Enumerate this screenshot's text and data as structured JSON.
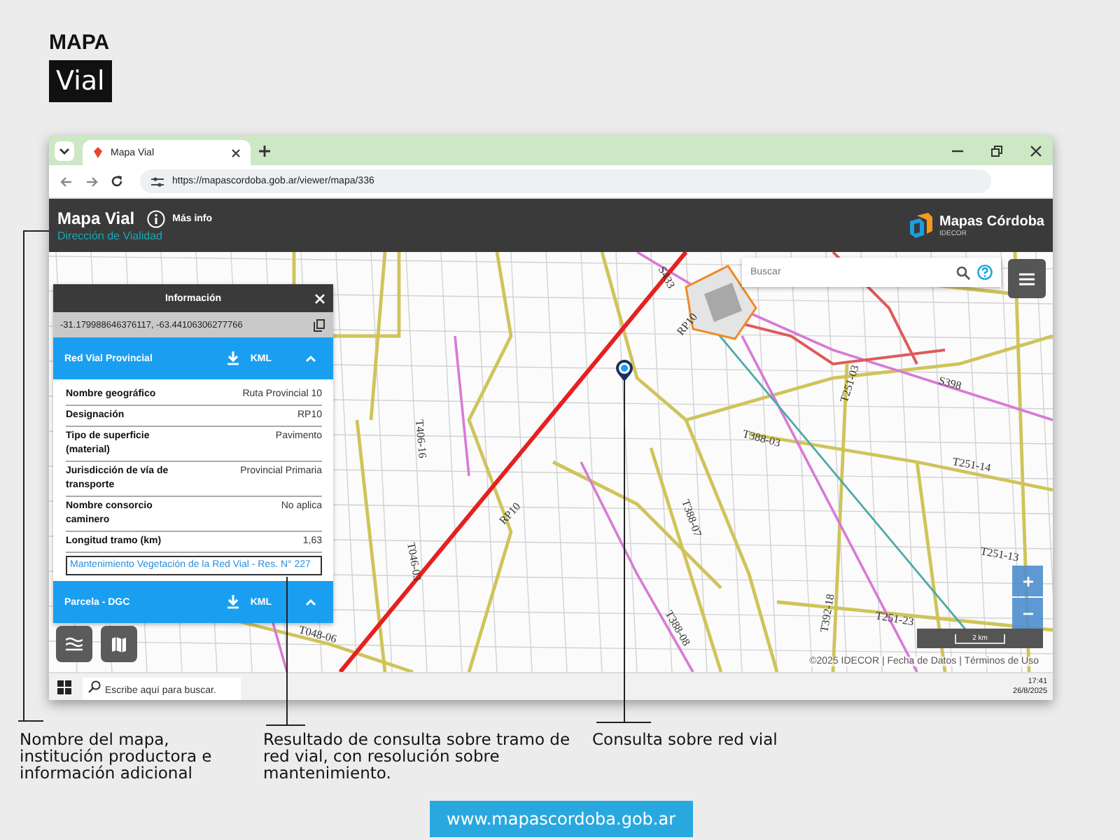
{
  "page_title": "MAPA",
  "page_subtitle": "Vial",
  "browser": {
    "tabs": [
      {
        "title": "Mapa Vial",
        "selected": true
      }
    ],
    "url": "https://mapascordoba.gob.ar/viewer/mapa/336"
  },
  "app_header": {
    "title": "Mapa Vial",
    "info_link": "Más info",
    "subtitle": "Dirección de Vialidad",
    "brand": "Mapas Córdoba",
    "brand_sub": "IDECOR"
  },
  "search": {
    "placeholder": "Buscar"
  },
  "info_panel": {
    "title": "Información",
    "coordinates": "-31.179988646376117, -63.44106306277766",
    "sections": [
      {
        "title": "Red Vial Provincial",
        "download": "KML",
        "expanded": true,
        "rows": [
          {
            "label": "Nombre geográfico",
            "value": "Ruta Provincial 10"
          },
          {
            "label": "Designación",
            "value": "RP10"
          },
          {
            "label": "Tipo de superficie (material)",
            "value": "Pavimento"
          },
          {
            "label": "Jurisdicción de vía de transporte",
            "value": "Provincial Primaria"
          },
          {
            "label": "Nombre consorcio caminero",
            "value": "No aplica"
          },
          {
            "label": "Longitud tramo (km)",
            "value": "1,63"
          }
        ],
        "link": "Mantenimiento Vegetación de la Red Vial - Res. N° 227"
      },
      {
        "title": "Parcela - DGC",
        "download": "KML",
        "expanded": true
      }
    ]
  },
  "map_labels": [
    "RP10",
    "RP10",
    "S433",
    "S398",
    "T406-16",
    "T388-03",
    "T251-03",
    "T251-14",
    "T251-13",
    "T251-23",
    "T392-18",
    "T388-08",
    "T046-03",
    "T048-06",
    "T388-07"
  ],
  "scale": "2 km",
  "attribution": "©2025 IDECOR | Fecha de Datos | Términos de Uso",
  "taskbar": {
    "search_placeholder": "Escribe aquí para buscar.",
    "time": "17:41",
    "date": "26/8/2025"
  },
  "captions": [
    "Nombre del mapa, institución productora e información adicional",
    "Resultado de consulta sobre tramo de red vial, con resolución sobre mantenimiento.",
    "Consulta sobre red vial"
  ],
  "footer_link": "www.mapascordoba.gob.ar"
}
